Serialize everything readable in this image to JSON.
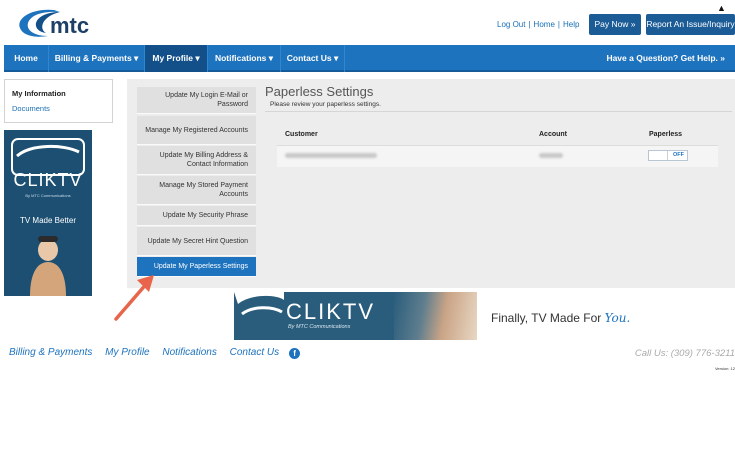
{
  "header": {
    "logo_text": "mtc",
    "top_links": [
      "Log Out",
      "Home",
      "Help"
    ],
    "pay_now": "Pay Now »",
    "report_issue": "Report An Issue/Inquiry"
  },
  "nav": {
    "items": [
      {
        "label": "Home"
      },
      {
        "label": "Billing & Payments ▾"
      },
      {
        "label": "My Profile ▾"
      },
      {
        "label": "Notifications ▾"
      },
      {
        "label": "Contact Us ▾"
      }
    ],
    "help": "Have a Question? Get Help. »"
  },
  "sidebar": {
    "title": "My Information",
    "link": "Documents"
  },
  "ad_left": {
    "brand": "CLIKTV",
    "sub": "By MTC Communications",
    "tagline": "TV Made Better"
  },
  "profile_menu": [
    "Update My Login E-Mail or Password",
    "Manage My Registered Accounts",
    "Update My Billing Address & Contact Information",
    "Manage My Stored Payment Accounts",
    "Update My Security Phrase",
    "Update My Secret Hint Question",
    "Update My Paperless Settings"
  ],
  "content": {
    "title": "Paperless Settings",
    "subtitle": "Please review your paperless settings.",
    "columns": [
      "Customer",
      "Account",
      "Paperless"
    ],
    "toggle_label": "OFF"
  },
  "banner": {
    "brand": "CLIKTV",
    "sub": "By MTC Communications",
    "tagline": "Finally, TV Made For",
    "tagline_you": "You."
  },
  "footer": {
    "links": [
      "Billing & Payments",
      "My Profile",
      "Notifications",
      "Contact Us"
    ],
    "facebook_glyph": "f",
    "call": "Call Us: (309) 776-3211",
    "version": "Version: 12"
  },
  "colors": {
    "primary": "#1e73be",
    "active_nav": "#13508a",
    "panel": "#ededed"
  }
}
